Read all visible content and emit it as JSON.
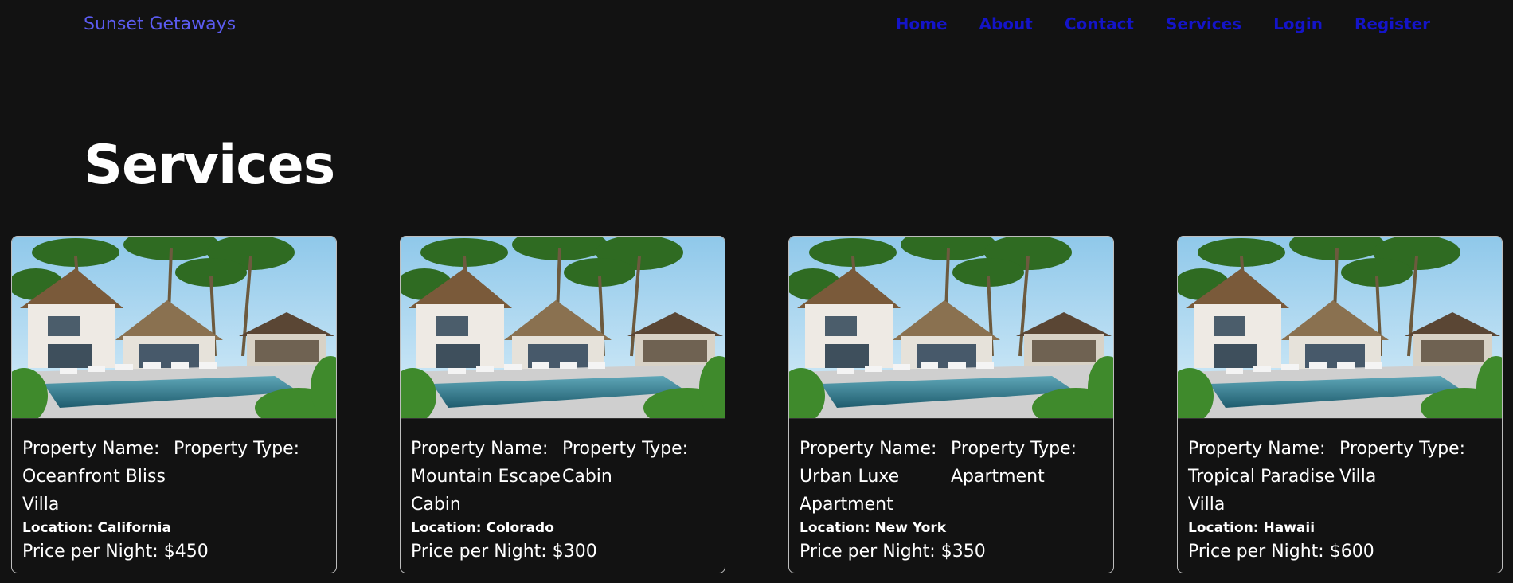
{
  "nav": {
    "brand": "Sunset Getaways",
    "links": [
      "Home",
      "About",
      "Contact",
      "Services",
      "Login",
      "Register"
    ]
  },
  "page": {
    "title": "Services"
  },
  "colors": {
    "background": "#121212",
    "brand": "#5b5bf0",
    "nav_link": "#1414c8",
    "card_border": "#bdbdbd"
  },
  "cards": [
    {
      "image": "beach-villa-pool-image",
      "name_label": "Property Name:",
      "name": "Oceanfront Bliss Villa",
      "type_label": "Property Type:",
      "type": "",
      "location": "Location: California",
      "price": "Price per Night: $450"
    },
    {
      "image": "beach-villa-pool-image",
      "name_label": "Property Name:",
      "name": "Mountain Escape Cabin",
      "type_label": "Property Type:",
      "type": "Cabin",
      "location": "Location: Colorado",
      "price": "Price per Night: $300"
    },
    {
      "image": "beach-villa-pool-image",
      "name_label": "Property Name:",
      "name": "Urban Luxe Apartment",
      "type_label": "Property Type:",
      "type": "Apartment",
      "location": "Location: New York",
      "price": "Price per Night: $350"
    },
    {
      "image": "beach-villa-pool-image",
      "name_label": "Property Name:",
      "name": "Tropical Paradise Villa",
      "type_label": "Property Type:",
      "type": "Villa",
      "location": "Location: Hawaii",
      "price": "Price per Night: $600"
    }
  ]
}
